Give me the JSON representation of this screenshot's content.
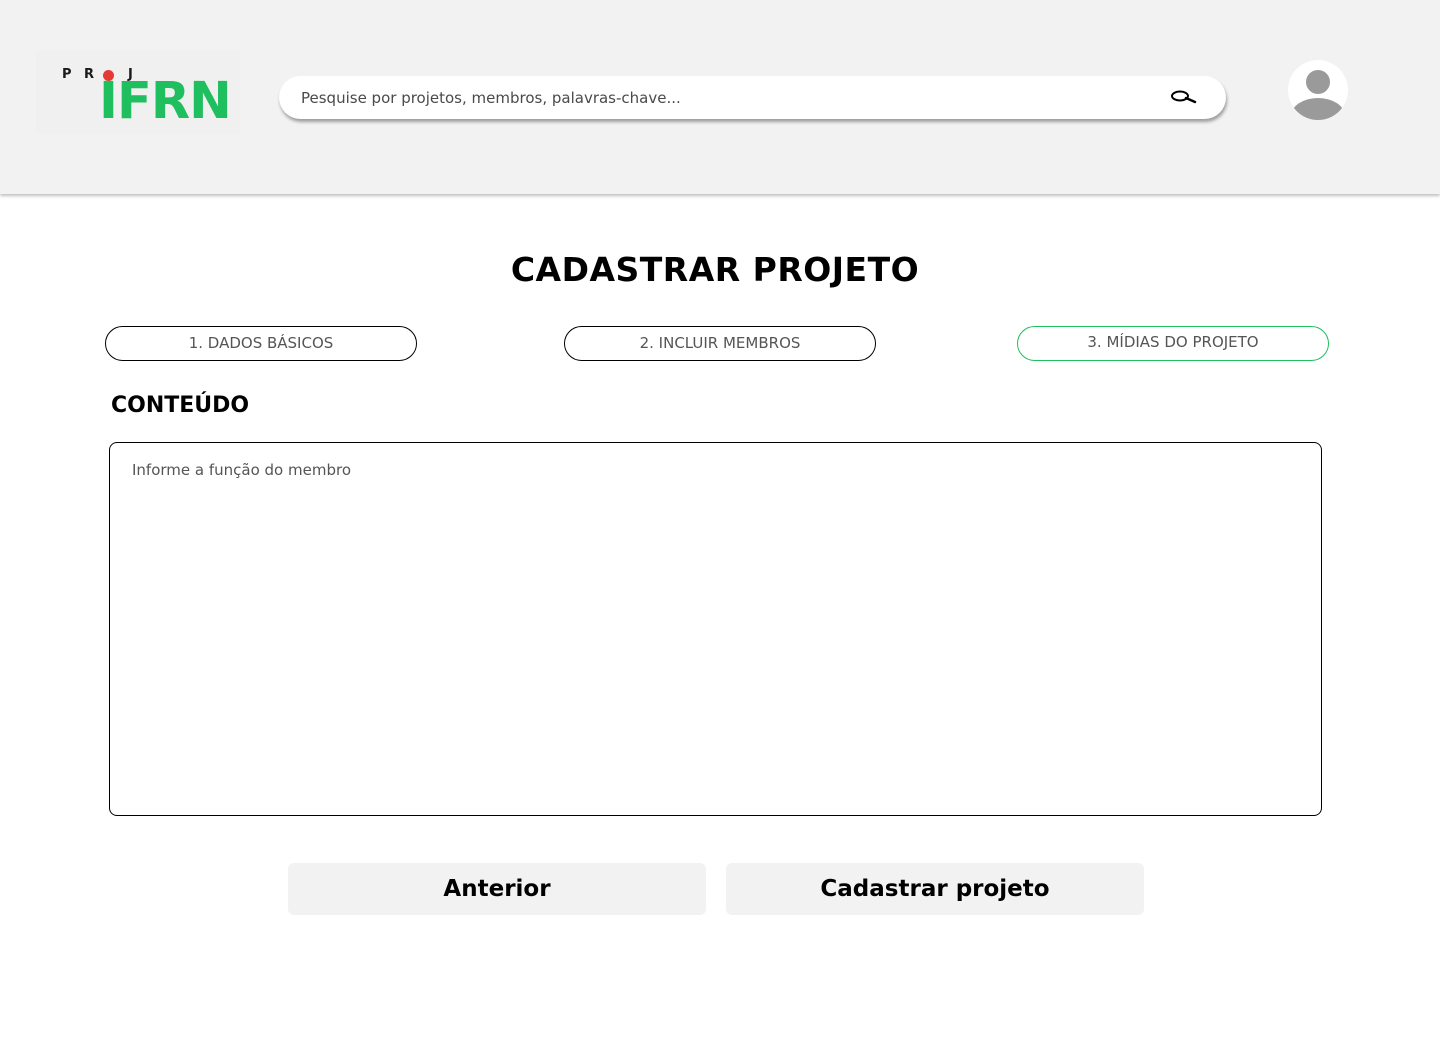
{
  "header": {
    "logo": {
      "letters": [
        "P",
        "R",
        "O",
        "J"
      ],
      "brand": "IFRN"
    },
    "search": {
      "placeholder": "Pesquise por projetos, membros, palavras-chave...",
      "icon": "search-icon"
    },
    "avatar": {
      "icon": "user-avatar-icon"
    }
  },
  "main": {
    "title": "CADASTRAR PROJETO",
    "steps": [
      {
        "label": "1. DADOS BÁSICOS",
        "active": false
      },
      {
        "label": "2. INCLUIR MEMBROS",
        "active": false
      },
      {
        "label": "3. MÍDIAS DO PROJETO",
        "active": true
      }
    ],
    "section_label": "CONTEÚDO",
    "content": {
      "placeholder": "Informe a função do membro"
    },
    "buttons": {
      "previous": "Anterior",
      "submit": "Cadastrar projeto"
    }
  },
  "colors": {
    "brand_green": "#1fbf5f",
    "brand_red": "#e53935",
    "header_bg": "#f2f2f2",
    "button_bg": "#f2f2f2"
  }
}
